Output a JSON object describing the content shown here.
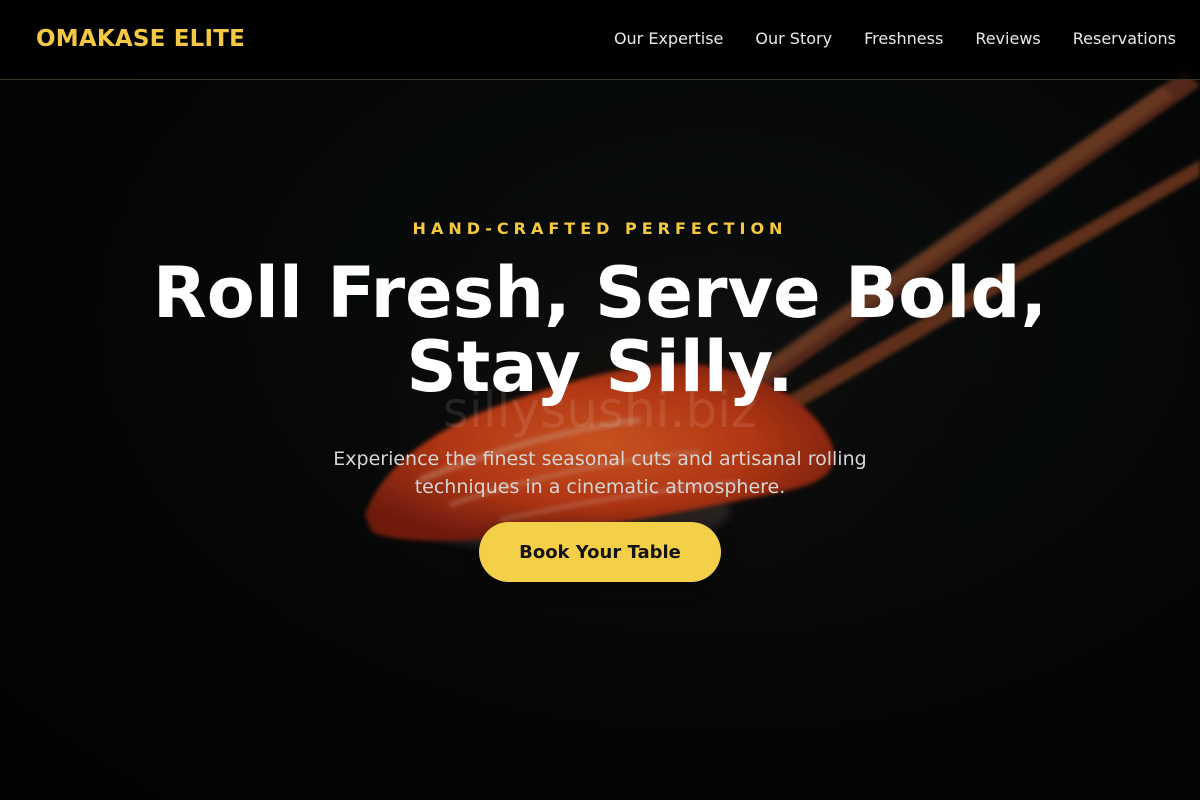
{
  "header": {
    "brand": "OMAKASE ELITE",
    "nav": [
      {
        "label": "Our Expertise"
      },
      {
        "label": "Our Story"
      },
      {
        "label": "Freshness"
      },
      {
        "label": "Reviews"
      },
      {
        "label": "Reservations"
      }
    ]
  },
  "hero": {
    "eyebrow": "HAND-CRAFTED PERFECTION",
    "headline_line1": "Roll Fresh, Serve Bold,",
    "headline_line2": "Stay Silly.",
    "subtitle": "Experience the finest seasonal cuts and artisanal rolling techniques in a cinematic atmosphere.",
    "cta_label": "Book Your Table",
    "image_subject": "salmon nigiri held by wooden chopsticks on dark background",
    "watermark_text": "sillysushi.biz"
  },
  "colors": {
    "accent": "#f4c842",
    "button": "#f4cf48",
    "background": "#050707",
    "headline": "#ffffff"
  }
}
